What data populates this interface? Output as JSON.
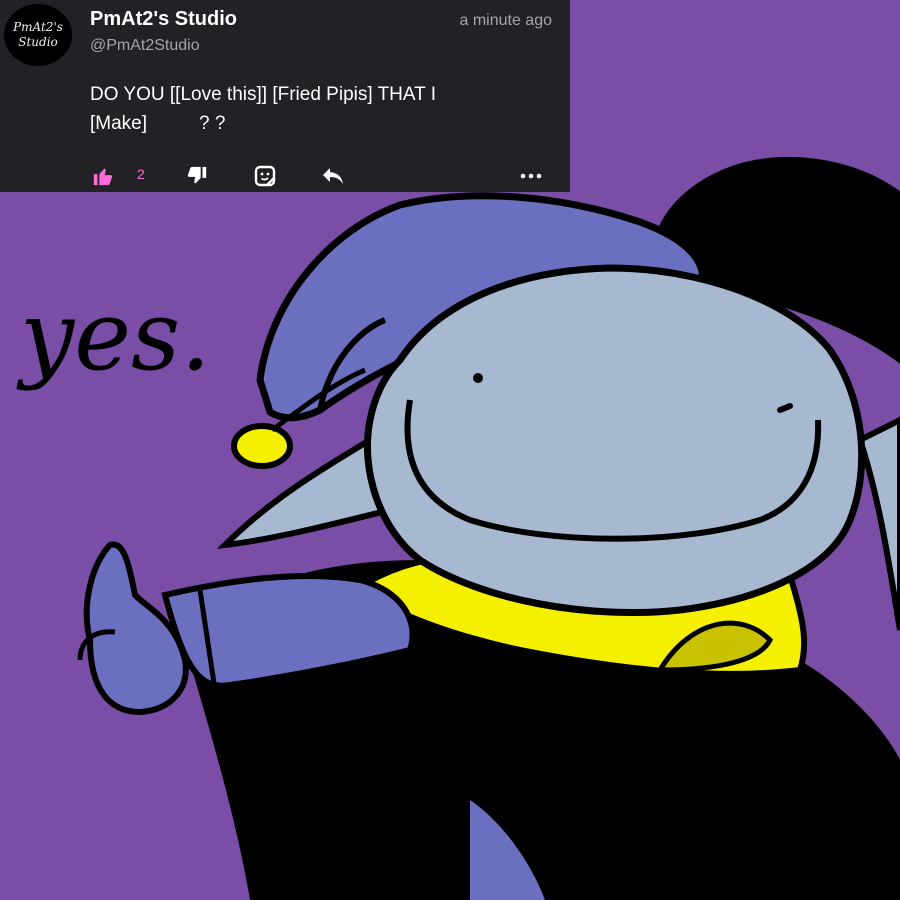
{
  "post": {
    "author_name": "PmAt2's Studio",
    "author_handle": "@PmAt2Studio",
    "timestamp": "a minute ago",
    "avatar_lines": [
      "PmAt2's",
      "Studio"
    ],
    "text_line1": "DO YOU [[Love this]] [Fried Pipis] THAT I",
    "text_line2_a": "[Make]",
    "text_line2_b": "? ?",
    "like_count": "2",
    "actions": {
      "like_icon": "thumbs-up-icon",
      "dislike_icon": "thumbs-down-icon",
      "sticker_icon": "sticker-icon",
      "reply_icon": "reply-icon",
      "more_icon": "more-icon"
    }
  },
  "drawing": {
    "caption": "yes."
  },
  "colors": {
    "background": "#7a4ea6",
    "card": "#222125",
    "accent_pink": "#ff6bd8",
    "hat": "#6b6fc0",
    "face": "#a6b9d1",
    "collar": "#f4f000"
  }
}
